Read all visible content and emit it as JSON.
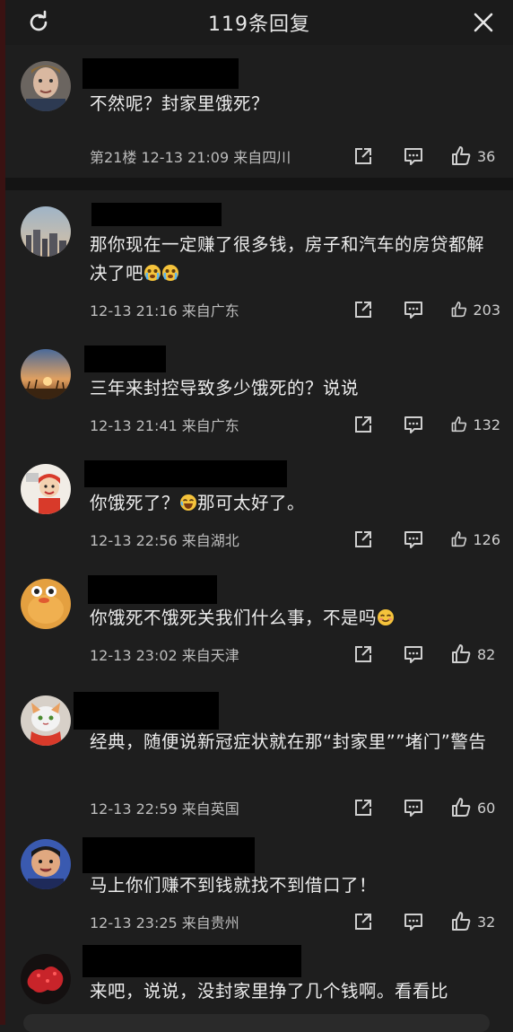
{
  "header": {
    "title": "119条回复"
  },
  "comments": [
    {
      "text": "不然呢？封家里饿死？",
      "meta": "第21楼 12-13 21:09 来自四川",
      "likes": "36"
    },
    {
      "text": "那你现在一定赚了很多钱，房子和汽车的房贷都解决了吧",
      "meta": "12-13 21:16 来自广东",
      "likes": "203"
    },
    {
      "text": "三年来封控导致多少饿死的？说说",
      "meta": "12-13 21:41 来自广东",
      "likes": "132"
    },
    {
      "text": "你饿死了？",
      "text2": "那可太好了。",
      "meta": "12-13 22:56 来自湖北",
      "likes": "126"
    },
    {
      "text": "你饿死不饿死关我们什么事，不是吗",
      "meta": "12-13 23:02 来自天津",
      "likes": "82"
    },
    {
      "text": "经典，随便说新冠症状就在那“封家里””堵门”警告",
      "meta": "12-13 22:59 来自英国",
      "likes": "60"
    },
    {
      "text": "马上你们赚不到钱就找不到借口了！",
      "meta": "12-13 23:25 来自贵州",
      "likes": "32"
    },
    {
      "text": "来吧，说说，没封家里挣了几个钱啊。看看比"
    }
  ],
  "icons": {
    "refresh": "refresh-icon",
    "close": "close-icon",
    "share": "share-icon",
    "reply": "reply-icon",
    "like": "thumbs-up-icon"
  },
  "colors": {
    "background": "#1e1e1e",
    "header": "#1b1b1b",
    "text": "#ececec",
    "meta": "#bdbdbd",
    "divider": "#141414"
  }
}
